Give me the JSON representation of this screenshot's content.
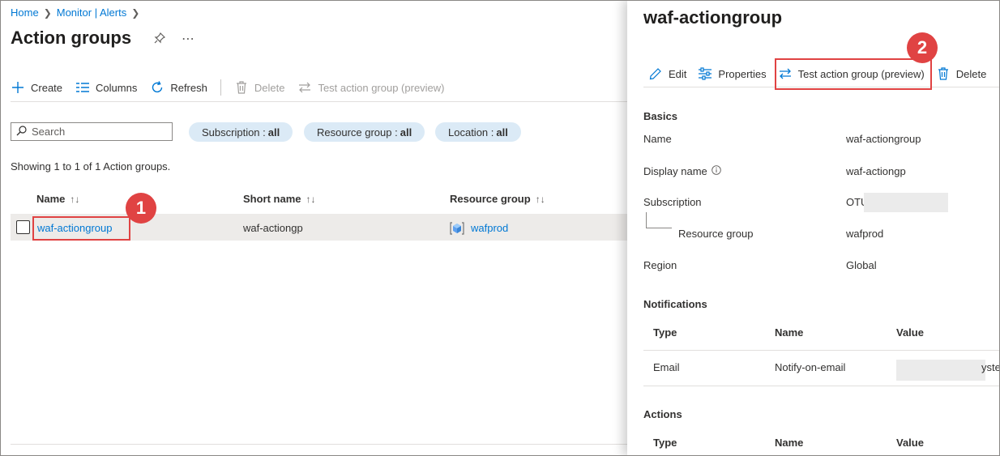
{
  "breadcrumb": {
    "home": "Home",
    "monitor": "Monitor | Alerts"
  },
  "page": {
    "title": "Action groups"
  },
  "toolbar": {
    "create": "Create",
    "columns": "Columns",
    "refresh": "Refresh",
    "delete": "Delete",
    "test": "Test action group (preview)"
  },
  "filters": {
    "search_placeholder": "Search",
    "subscription_label": "Subscription :",
    "subscription_value": "all",
    "resource_group_label": "Resource group :",
    "resource_group_value": "all",
    "location_label": "Location :",
    "location_value": "all"
  },
  "list": {
    "showing": "Showing 1 to 1 of 1 Action groups.",
    "columns": [
      "Name",
      "Short name",
      "Resource group"
    ],
    "rows": [
      {
        "name": "waf-actiongroup",
        "short_name": "waf-actiongp",
        "resource_group": "wafprod"
      }
    ]
  },
  "panel": {
    "title": "waf-actiongroup",
    "toolbar": {
      "edit": "Edit",
      "properties": "Properties",
      "test": "Test action group (preview)",
      "delete": "Delete"
    },
    "basics": {
      "section": "Basics",
      "name_label": "Name",
      "name_value": "waf-actiongroup",
      "display_name_label": "Display name",
      "display_name_value": "waf-actiongp",
      "subscription_label": "Subscription",
      "subscription_value": "OTU",
      "resource_group_label": "Resource group",
      "resource_group_value": "wafprod",
      "region_label": "Region",
      "region_value": "Global"
    },
    "notifications": {
      "section": "Notifications",
      "headers": [
        "Type",
        "Name",
        "Value"
      ],
      "rows": [
        {
          "type": "Email",
          "name": "Notify-on-email",
          "value": "yste"
        }
      ]
    },
    "actions": {
      "section": "Actions",
      "headers": [
        "Type",
        "Name",
        "Value"
      ]
    }
  },
  "callouts": {
    "first": "1",
    "second": "2"
  },
  "colors": {
    "accent": "#0078d4",
    "callout": "#e04343",
    "pill": "#dbeaf6"
  }
}
